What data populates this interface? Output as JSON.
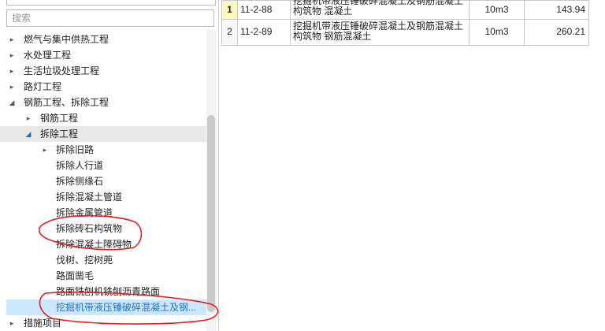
{
  "search": {
    "placeholder": "搜索"
  },
  "tree": {
    "items": [
      {
        "label": "燃气与集中供热工程",
        "arrow": "▸",
        "level": 0
      },
      {
        "label": "水处理工程",
        "arrow": "▸",
        "level": 0
      },
      {
        "label": "生活垃圾处理工程",
        "arrow": "▸",
        "level": 0
      },
      {
        "label": "路灯工程",
        "arrow": "▸",
        "level": 0
      },
      {
        "label": "钢筋工程、拆除工程",
        "arrow": "◢",
        "level": 0
      },
      {
        "label": "钢筋工程",
        "arrow": "▸",
        "level": 1
      },
      {
        "label": "拆除工程",
        "arrow": "◢",
        "level": 1,
        "state": "selected"
      },
      {
        "label": "拆除旧路",
        "arrow": "▸",
        "level": 2
      },
      {
        "label": "拆除人行道",
        "arrow": "",
        "level": 2
      },
      {
        "label": "拆除侧缘石",
        "arrow": "",
        "level": 2
      },
      {
        "label": "拆除混凝土管道",
        "arrow": "",
        "level": 2
      },
      {
        "label": "拆除金属管道",
        "arrow": "",
        "level": 2
      },
      {
        "label": "拆除砖石构筑物",
        "arrow": "",
        "level": 2
      },
      {
        "label": "拆除混凝土障碍物",
        "arrow": "",
        "level": 2
      },
      {
        "label": "伐树、挖树蔸",
        "arrow": "",
        "level": 2
      },
      {
        "label": "路面凿毛",
        "arrow": "",
        "level": 2
      },
      {
        "label": "路面铣刨机铣刨沥青路面",
        "arrow": "",
        "level": 2
      },
      {
        "label": "挖掘机带液压锤破碎混凝土及钢...",
        "arrow": "",
        "level": 2,
        "state": "highlighted"
      },
      {
        "label": "措施项目",
        "arrow": "▸",
        "level": 0
      }
    ]
  },
  "grid": {
    "rows": [
      {
        "no": "1",
        "code": "11-2-88",
        "name": "挖掘机带液压锤破碎混凝土及钢筋混凝土构筑物 混凝土",
        "unit": "10m3",
        "qty": "143.94",
        "current": true
      },
      {
        "no": "2",
        "code": "11-2-89",
        "name": "挖掘机带液压锤破碎混凝土及钢筋混凝土构筑物 钢筋混凝土",
        "unit": "10m3",
        "qty": "260.21",
        "current": false
      }
    ]
  },
  "colors": {
    "highlight_bg": "#cce8ff",
    "highlight_text": "#1e70c8",
    "selected_bg": "#e8e8e8",
    "annotation": "#e0201b"
  }
}
